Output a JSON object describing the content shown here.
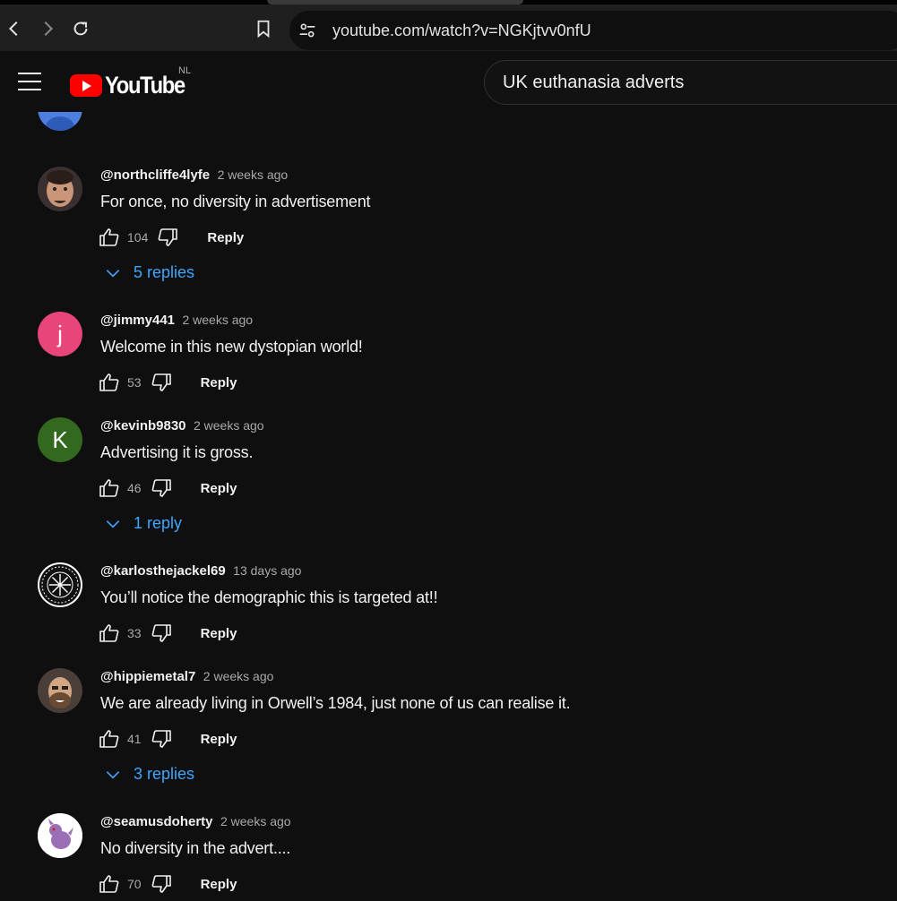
{
  "browser": {
    "url": "youtube.com/watch?v=NGKjtvv0nfU"
  },
  "header": {
    "logo_text": "YouTube",
    "country_code": "NL",
    "search_value": "UK euthanasia adverts"
  },
  "comments": [
    {
      "author": "@northcliffe4lyfe",
      "time": "2 weeks ago",
      "text": "For once, no diversity in advertisement",
      "likes": "104",
      "reply_label": "Reply",
      "replies": "5 replies",
      "avatar_letter": "",
      "avatar_color": "#7a5a48"
    },
    {
      "author": "@jimmy441",
      "time": "2 weeks ago",
      "text": "Welcome in this new dystopian world!",
      "likes": "53",
      "reply_label": "Reply",
      "avatar_letter": "j",
      "avatar_color": "#e8457a"
    },
    {
      "author": "@kevinb9830",
      "time": "2 weeks ago",
      "text": "Advertising it is gross.",
      "likes": "46",
      "reply_label": "Reply",
      "replies": "1 reply",
      "avatar_letter": "K",
      "avatar_color": "#33691e"
    },
    {
      "author": "@karlosthejackel69",
      "time": "13 days ago",
      "text": "You’ll notice the demographic this is targeted at!!",
      "likes": "33",
      "reply_label": "Reply",
      "avatar_letter": "",
      "avatar_color": "#ffffff"
    },
    {
      "author": "@hippiemetal7",
      "time": "2 weeks ago",
      "text": "We are already living in Orwell’s 1984, just none of us can realise it.",
      "likes": "41",
      "reply_label": "Reply",
      "replies": "3 replies",
      "avatar_letter": "",
      "avatar_color": "#8a6a50"
    },
    {
      "author": "@seamusdoherty",
      "time": "2 weeks ago",
      "text": "No diversity in the advert....",
      "likes": "70",
      "reply_label": "Reply",
      "avatar_letter": "",
      "avatar_color": "#ffffff"
    }
  ],
  "colors": {
    "background": "#0f0f0f",
    "link_blue": "#3ea6ff",
    "brand_red": "#ff0000",
    "secondary_text": "#aaaaaa"
  },
  "icons": {
    "back": "arrow-left-icon",
    "forward": "arrow-right-icon",
    "reload": "reload-icon",
    "bookmark": "bookmark-icon",
    "site_settings": "tune-icon",
    "menu": "hamburger-icon",
    "like": "thumbs-up-icon",
    "dislike": "thumbs-down-icon",
    "expand": "chevron-down-icon"
  }
}
